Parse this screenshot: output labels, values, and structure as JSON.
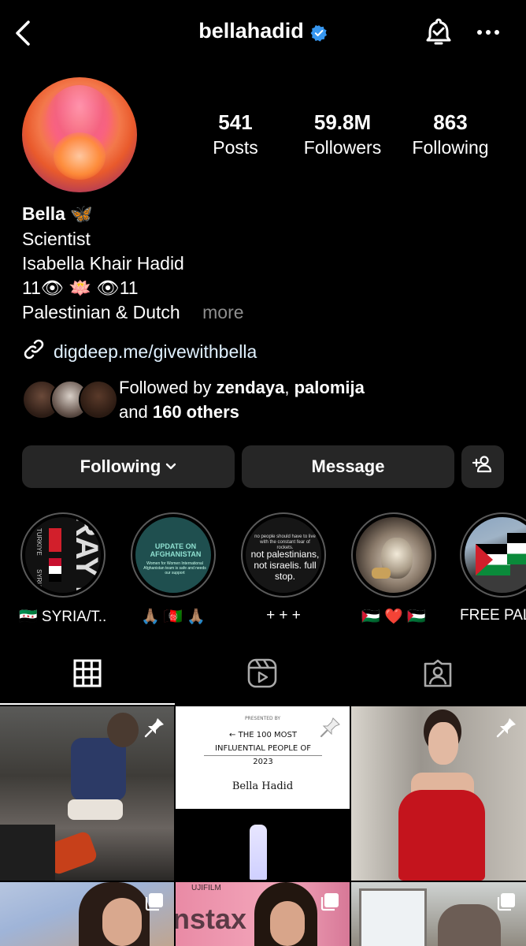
{
  "header": {
    "username": "bellahadid",
    "back_icon": "chevron-left-icon",
    "verified_icon": "verified-badge-icon",
    "notify_icon": "bell-check-icon",
    "more_icon": "more-horizontal-icon"
  },
  "stats": [
    {
      "value": "541",
      "label": "Posts"
    },
    {
      "value": "59.8M",
      "label": "Followers"
    },
    {
      "value": "863",
      "label": "Following"
    }
  ],
  "bio": {
    "name": "Bella",
    "name_emoji": "🦋",
    "category": "Scientist",
    "full_name": "Isabella Khair Hadid",
    "line3": "11👁 🪷 👁11",
    "line4": "Palestinian & Dutch",
    "more": "more",
    "link": "digdeep.me/givewithbella"
  },
  "followed_by": {
    "prefix": "Followed by",
    "user1": "zendaya",
    "separator": ",",
    "user2": "palomija",
    "and": "and",
    "others": "160 others"
  },
  "actions": {
    "following": "Following",
    "message": "Message",
    "add_user_icon": "add-person-icon"
  },
  "highlights": [
    {
      "label": "🇸🇾 SYRIA/T..."
    },
    {
      "label": "🙏🏽 🇦🇫 🙏🏽"
    },
    {
      "label": "+ + +"
    },
    {
      "label": "🇵🇸 ❤️ 🇵🇸"
    },
    {
      "label": "FREE PAL"
    }
  ],
  "highlight_text": {
    "h1_turkiye": "TURKIYE",
    "h1_syria": "SYRIA",
    "h1_big": "RAY FO",
    "h2_title": "UPDATE ON AFGHANISTAN",
    "h2_sub": "Women for Women International Afghanistan team is safe and needs our support",
    "h3_top": "no people should have to live with the constant fear of rockets.",
    "h3_main": "not palestinians, not israelis. full stop."
  },
  "tabs": [
    {
      "icon": "grid-icon"
    },
    {
      "icon": "reels-icon"
    },
    {
      "icon": "tagged-icon"
    }
  ],
  "post2": {
    "presented": "PRESENTED BY",
    "headline": "← THE 100 MOST INFLUENTIAL PEOPLE OF 2023",
    "name": "Bella Hadid"
  },
  "post5": {
    "text": "nstax",
    "top": "UJIFILM"
  },
  "colors": {
    "background": "#000000",
    "button": "#262626",
    "verified": "#3797f0",
    "link": "#e0f1ff",
    "muted": "#8e8e8e"
  }
}
